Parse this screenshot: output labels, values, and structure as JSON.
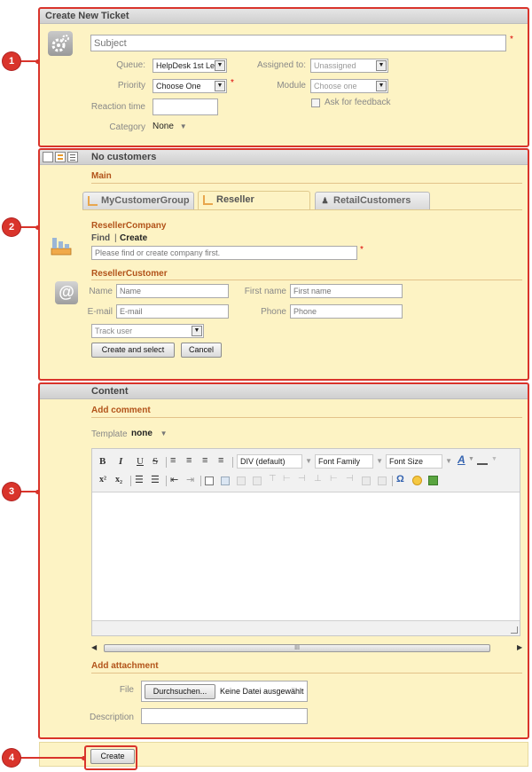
{
  "header": {
    "title": "Create New Ticket"
  },
  "form": {
    "subject_placeholder": "Subject",
    "queue_label": "Queue:",
    "queue_value": "HelpDesk 1st Le",
    "assigned_label": "Assigned to:",
    "assigned_value": "Unassigned",
    "priority_label": "Priority",
    "priority_value": "Choose One",
    "module_label": "Module",
    "module_value": "Choose one",
    "reaction_label": "Reaction time",
    "feedback_label": "Ask for feedback",
    "category_label": "Category",
    "category_value": "None"
  },
  "customers": {
    "title": "No customers",
    "main_label": "Main",
    "tabs": [
      "MyCustomerGroup",
      "Reseller",
      "RetailCustomers"
    ],
    "company_section": "ResellerCompany",
    "find": "Find",
    "divider": "|",
    "create": "Create",
    "company_placeholder": "Please find or create company first.",
    "customer_section": "ResellerCustomer",
    "name_label": "Name",
    "name_placeholder": "Name",
    "firstname_label": "First name",
    "firstname_placeholder": "First name",
    "email_label": "E-mail",
    "email_placeholder": "E-mail",
    "phone_label": "Phone",
    "phone_placeholder": "Phone",
    "track_value": "Track user",
    "create_select_button": "Create and select",
    "cancel_button": "Cancel"
  },
  "content": {
    "title": "Content",
    "add_comment": "Add comment",
    "template_label": "Template",
    "template_value": "none",
    "toolbar": {
      "bold": "B",
      "italic": "I",
      "underline": "U",
      "strike": "S",
      "format": "DIV (default)",
      "font_family": "Font Family",
      "font_size": "Font Size",
      "font_color": "A",
      "sup": "x²",
      "sub": "x₂",
      "omega": "Ω"
    },
    "scroll_grip": "III",
    "add_attachment": "Add attachment",
    "file_label": "File",
    "browse_button": "Durchsuchen...",
    "no_file": "Keine Datei ausgewählt",
    "description_label": "Description"
  },
  "footer": {
    "create_button": "Create"
  },
  "callouts": [
    "1",
    "2",
    "3",
    "4"
  ],
  "colors": {
    "highlight": "#d9342b",
    "panel": "#fdf3c4",
    "section": "#b2531a"
  }
}
